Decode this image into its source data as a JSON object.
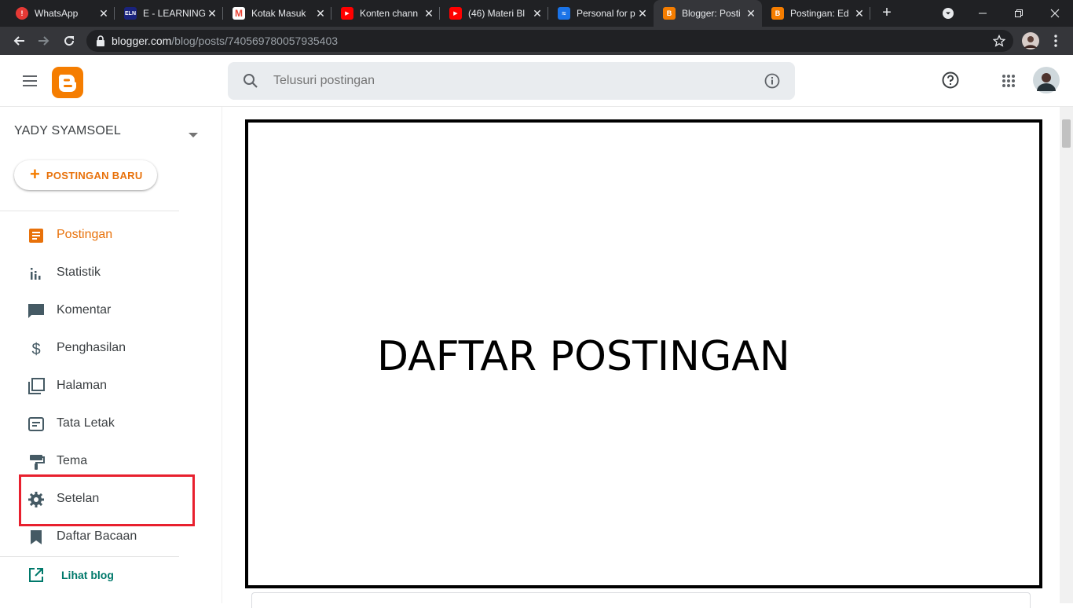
{
  "browser": {
    "tabs": [
      {
        "title": "WhatsApp",
        "favicon": "whatsapp-icon",
        "color": "#e53935"
      },
      {
        "title": "E - LEARNING",
        "favicon": "eln-icon",
        "color": "#1a237e"
      },
      {
        "title": "Kotak Masuk",
        "favicon": "gmail-icon",
        "color": "#ea4335"
      },
      {
        "title": "Konten chann",
        "favicon": "youtube-icon",
        "color": "#ff0000"
      },
      {
        "title": "(46) Materi Bl",
        "favicon": "youtube-icon",
        "color": "#ff0000"
      },
      {
        "title": "Personal for p",
        "favicon": "personal-icon",
        "color": "#1a73e8"
      },
      {
        "title": "Blogger: Posti",
        "favicon": "blogger-icon",
        "color": "#f57d00"
      },
      {
        "title": "Postingan: Ed",
        "favicon": "blogger-icon",
        "color": "#f57d00"
      }
    ],
    "active_tab": 6,
    "url_host": "blogger.com",
    "url_path": "/blog/posts/740569780057935403"
  },
  "header": {
    "search_placeholder": "Telusuri postingan"
  },
  "sidebar": {
    "blog_name": "YADY SYAMSOEL",
    "new_post_label": "POSTINGAN BARU",
    "items": [
      {
        "label": "Postingan",
        "icon": "posts-icon",
        "active": true
      },
      {
        "label": "Statistik",
        "icon": "stats-icon",
        "active": false
      },
      {
        "label": "Komentar",
        "icon": "comment-icon",
        "active": false
      },
      {
        "label": "Penghasilan",
        "icon": "dollar-icon",
        "active": false
      },
      {
        "label": "Halaman",
        "icon": "pages-icon",
        "active": false
      },
      {
        "label": "Tata Letak",
        "icon": "layout-icon",
        "active": false
      },
      {
        "label": "Tema",
        "icon": "theme-icon",
        "active": false
      },
      {
        "label": "Setelan",
        "icon": "gear-icon",
        "active": false
      },
      {
        "label": "Daftar Bacaan",
        "icon": "bookmark-icon",
        "active": false
      }
    ],
    "view_blog_label": "Lihat blog"
  },
  "main": {
    "title_text": "DAFTAR POSTINGAN"
  },
  "colors": {
    "accent": "#f57d00",
    "accent_text": "#e8710a",
    "highlight": "#e8202e",
    "teal": "#00796b"
  }
}
